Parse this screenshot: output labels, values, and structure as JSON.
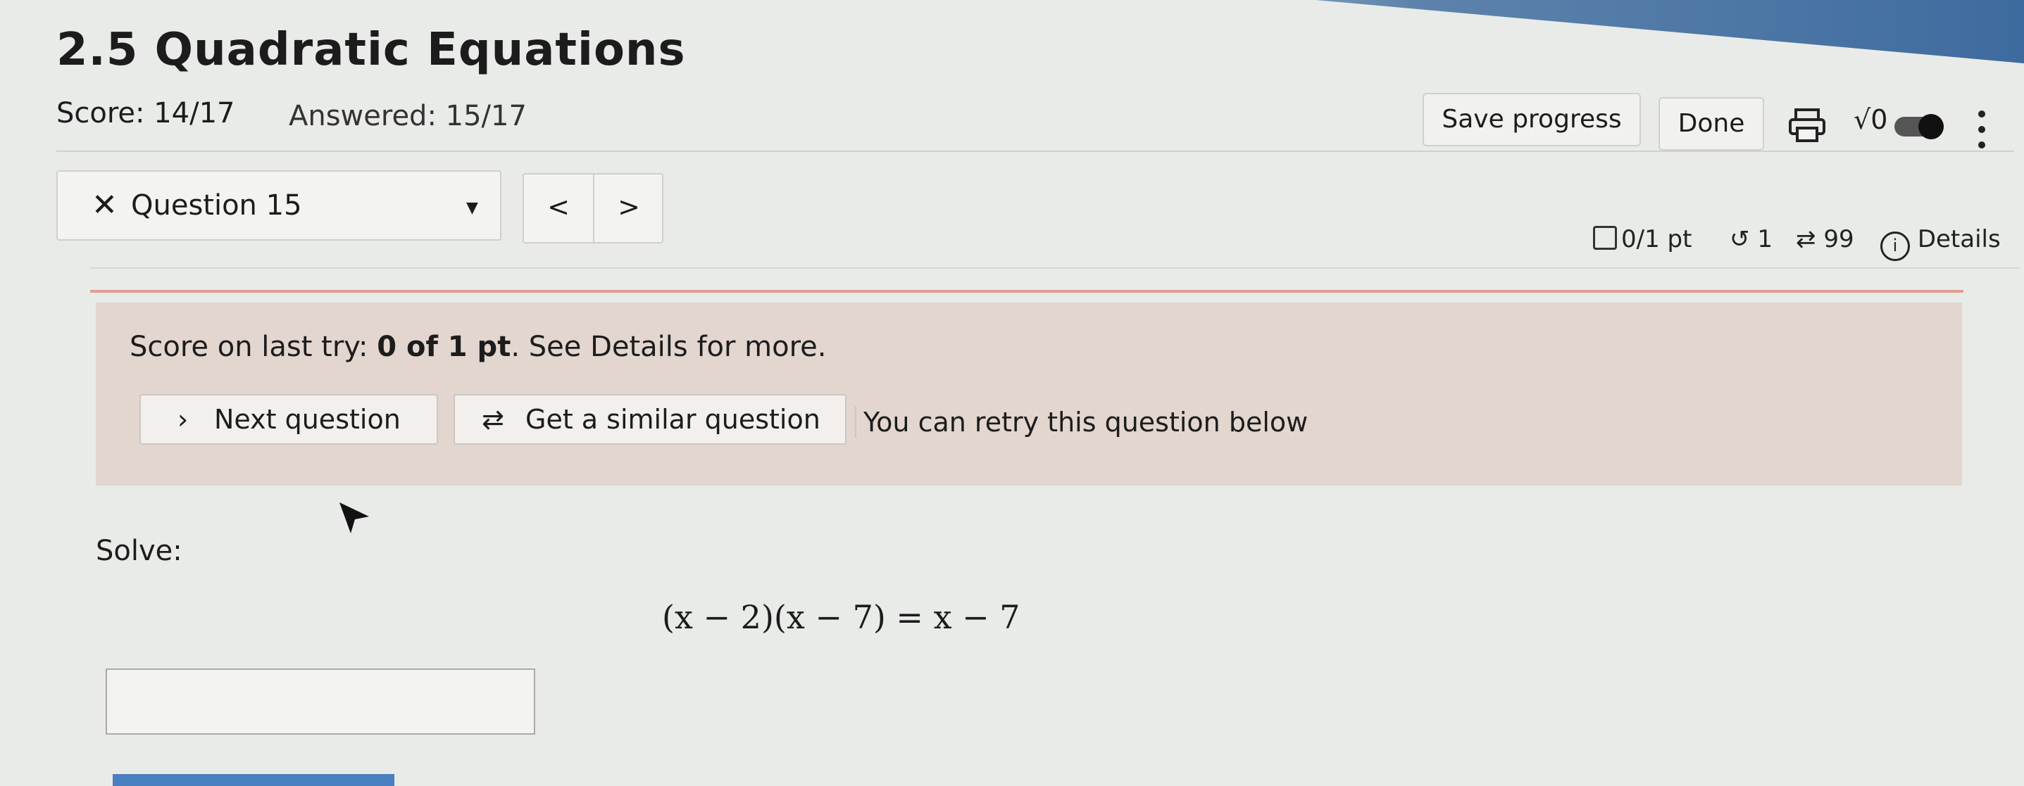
{
  "header": {
    "title": "2.5 Quadratic Equations",
    "score": "Score: 14/17",
    "answered": "Answered: 15/17",
    "save_label": "Save progress",
    "done_label": "Done",
    "sqrt_label": "√0",
    "icons": [
      "print-icon",
      "math-toggle-icon",
      "more-vertical-icon"
    ]
  },
  "question_nav": {
    "selected": "Question 15",
    "prev": "<",
    "next": ">"
  },
  "question_meta": {
    "points": "0/1 pt",
    "retries": "1",
    "attempts": "99",
    "details_label": "Details"
  },
  "feedback": {
    "score_prefix": "Score on last try: ",
    "score_value": "0 of 1 pt",
    "score_suffix": ". See Details for more.",
    "next_label": "Next question",
    "similar_label": "Get a similar question",
    "retry_text": "You can retry this question below"
  },
  "problem": {
    "instruction": "Solve:",
    "equation": "(x − 2)(x − 7) = x − 7",
    "answer_value": ""
  },
  "colors": {
    "feedback_bg": "#e2d6cf",
    "accent_line": "#d98a7a",
    "bottom_button": "#4a7fc0"
  }
}
